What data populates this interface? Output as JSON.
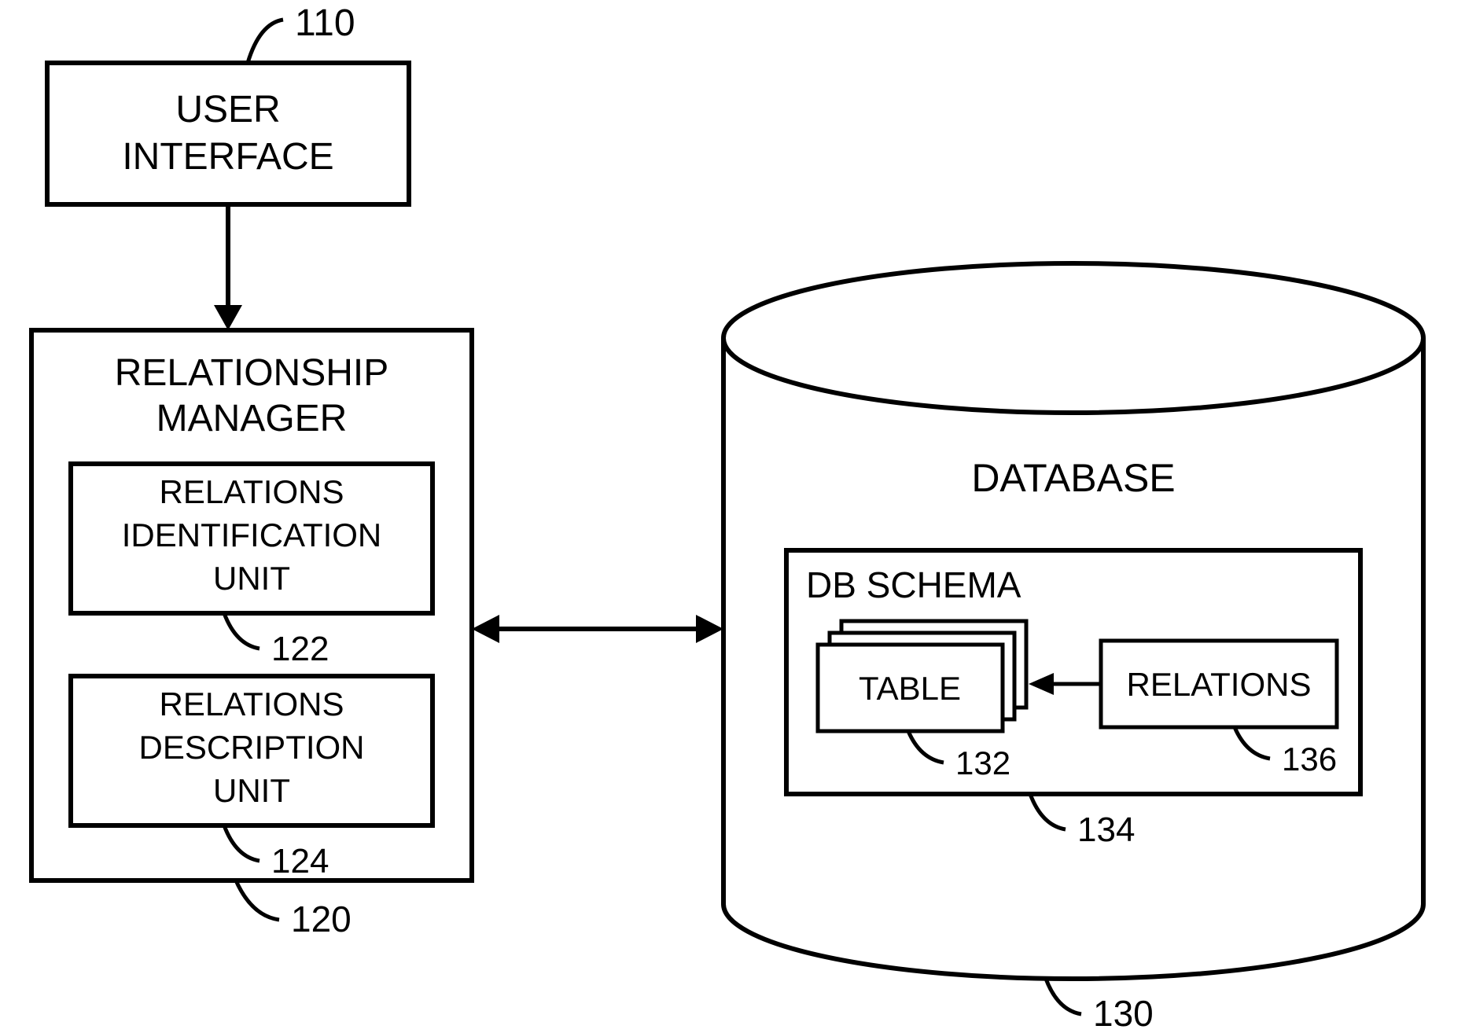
{
  "nodes": {
    "user_interface": {
      "label_l1": "USER",
      "label_l2": "INTERFACE",
      "ref": "110"
    },
    "relationship_manager": {
      "title_l1": "RELATIONSHIP",
      "title_l2": "MANAGER",
      "ref": "120",
      "children": {
        "relations_identification_unit": {
          "l1": "RELATIONS",
          "l2": "IDENTIFICATION",
          "l3": "UNIT",
          "ref": "122"
        },
        "relations_description_unit": {
          "l1": "RELATIONS",
          "l2": "DESCRIPTION",
          "l3": "UNIT",
          "ref": "124"
        }
      }
    },
    "database": {
      "title": "DATABASE",
      "ref": "130",
      "schema": {
        "title": "DB SCHEMA",
        "ref": "134",
        "table": {
          "label": "TABLE",
          "ref": "132"
        },
        "relations": {
          "label": "RELATIONS",
          "ref": "136"
        }
      }
    }
  }
}
